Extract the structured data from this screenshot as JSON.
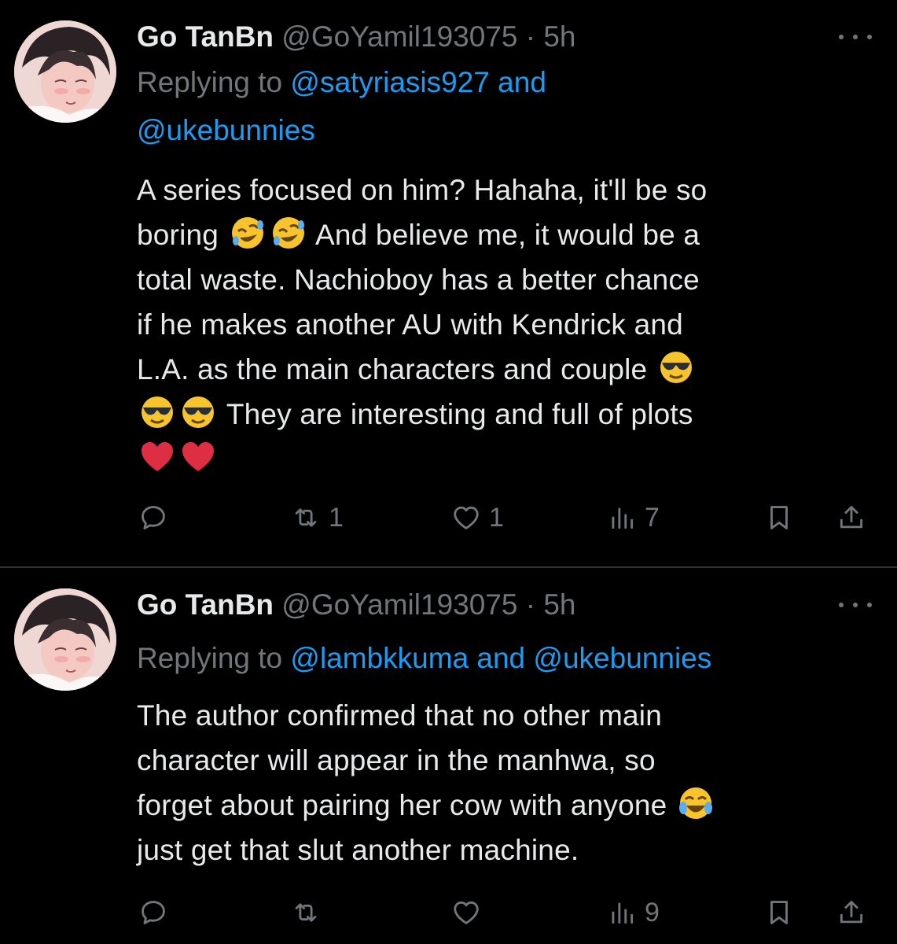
{
  "tweets": [
    {
      "name": "Go TanBn",
      "handle": "@GoYamil193075",
      "dot": "·",
      "time": "5h",
      "replying_prefix": "Replying to ",
      "replying_line1": "@satyriasis927 and",
      "replying_line2": "@ukebunnies",
      "body_lines": [
        "A series focused on him? Hahaha, it'll be so",
        "boring",
        "And believe me, it would be a",
        "total waste. Nachioboy has a better chance",
        "if he makes another AU with Kendrick and",
        "L.A. as the main characters and couple",
        "They are interesting and full of plots"
      ],
      "stats": {
        "replies": "",
        "retweets": "1",
        "likes": "1",
        "views": "7"
      }
    },
    {
      "name": "Go TanBn",
      "handle": "@GoYamil193075",
      "dot": "·",
      "time": "5h",
      "replying_prefix": "Replying to ",
      "replying_line1": "@lambkkuma and @ukebunnies",
      "body_lines": [
        "The author confirmed that no other main",
        "character will appear in the manhwa, so",
        "forget about pairing her cow with anyone",
        "just get that slut another machine."
      ],
      "stats": {
        "replies": "",
        "retweets": "",
        "likes": "",
        "views": "9"
      }
    }
  ],
  "icons": {
    "reply": "reply-icon",
    "retweet": "retweet-icon",
    "like": "heart-icon",
    "views": "views-icon",
    "bookmark": "bookmark-icon",
    "share": "share-icon",
    "more": "more-icon"
  },
  "colors": {
    "background": "#000000",
    "text": "#e7e9ea",
    "muted": "#71767b",
    "link": "#1d9bf0"
  }
}
